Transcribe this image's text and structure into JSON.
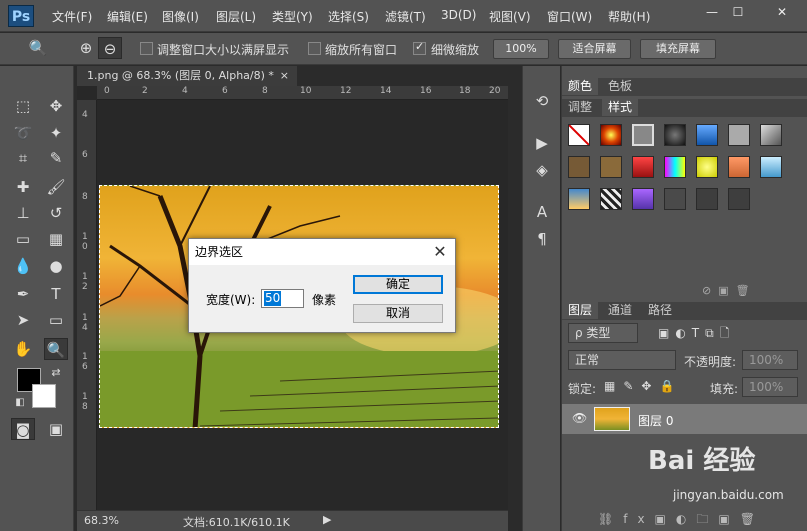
{
  "app": {
    "logo": "Ps"
  },
  "menu": [
    "文件(F)",
    "编辑(E)",
    "图像(I)",
    "图层(L)",
    "类型(Y)",
    "选择(S)",
    "滤镜(T)",
    "3D(D)",
    "视图(V)",
    "窗口(W)",
    "帮助(H)"
  ],
  "window_controls": {
    "minimize": "—",
    "maximize": "☐",
    "close": "✕"
  },
  "options": {
    "resize_windows_label": "调整窗口大小以满屏显示",
    "zoom_all_label": "缩放所有窗口",
    "scrubby_label": "细微缩放",
    "zoom_100": "100%",
    "fit_screen": "适合屏幕",
    "fill_screen": "填充屏幕",
    "resize_checked": false,
    "zoom_all_checked": false,
    "scrubby_checked": true
  },
  "document": {
    "tab_title": "1.png @ 68.3% (图层 0, Alpha/8) *",
    "close": "×",
    "ruler_h": [
      "0",
      "2",
      "4",
      "6",
      "8",
      "10",
      "12",
      "14",
      "16",
      "18",
      "20"
    ],
    "ruler_v": [
      "4",
      "6",
      "8",
      "1 0",
      "1 2",
      "1 4",
      "1 6",
      "1 8"
    ],
    "zoom": "68.3%",
    "doc_info": "文档:610.1K/610.1K"
  },
  "dialog": {
    "title": "边界选区",
    "width_label": "宽度(W):",
    "width_value": "50",
    "unit": "像素",
    "ok": "确定",
    "cancel": "取消"
  },
  "panels": {
    "color_tabs": [
      "颜色",
      "色板"
    ],
    "style_tabs": [
      "调整",
      "样式"
    ],
    "layer_tabs": [
      "图层",
      "通道",
      "路径"
    ],
    "kind_filter": "ρ 类型",
    "blend_mode": "正常",
    "opacity_label": "不透明度:",
    "opacity_value": "100%",
    "lock_label": "锁定:",
    "fill_label": "填充:",
    "fill_value": "100%",
    "layer_name": "图层 0"
  },
  "watermark": {
    "brand": "Bai 经验",
    "url": "jingyan.baidu.com"
  },
  "colors": {
    "bg": "#535353",
    "dark": "#2b2b2b",
    "accent": "#0078d7"
  }
}
